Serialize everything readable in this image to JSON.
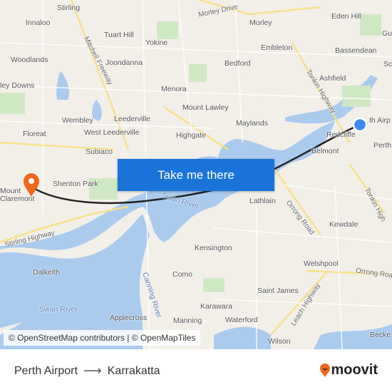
{
  "map": {
    "labels": [
      "Stirling",
      "Innaloo",
      "Woodlands",
      "ley Downs",
      "Tuart Hill",
      "Yokine",
      "Joondanna",
      "Morley Drive",
      "Morley",
      "Eden Hill",
      "Bassendean",
      "Embleton",
      "Bedford",
      "Ashfield",
      "Menora",
      "Mount Lawley",
      "Maylands",
      "Wembley",
      "Leederville",
      "West Leederville",
      "Highgate",
      "Floreat",
      "Subiaco",
      "Redcliffe",
      "Belmont",
      "th Airp",
      "Perth",
      "Shenton Park",
      "Mount\nClaremont",
      "Lathlain",
      "Kewdale",
      "Kensington",
      "Welshpool",
      "Dalkeith",
      "Como",
      "Saint James",
      "Applecross",
      "Karawara",
      "Manning",
      "Waterford",
      "Wilson",
      "Becke",
      "Sc",
      "Gu"
    ],
    "water_labels": [
      "Swan River",
      "Swan River",
      "Canning River"
    ],
    "road_labels": [
      "Mitchell Freeway",
      "Tonkin Highway",
      "Orrong Road",
      "Stirling Highway",
      "Orrong Roa",
      "Leach Highway",
      "Tonkin High"
    ],
    "cta_label": "Take me there",
    "attribution": "© OpenStreetMap contributors | © OpenMapTiles",
    "colors": {
      "water": "#aacbee",
      "route": "#222222",
      "origin": "#3d8bf2",
      "destination": "#f0671c",
      "button": "#1a73d9"
    }
  },
  "footer": {
    "origin": "Perth Airport",
    "destination": "Karrakatta",
    "arrow_icon": "arrow-right",
    "brand": "moovit"
  }
}
